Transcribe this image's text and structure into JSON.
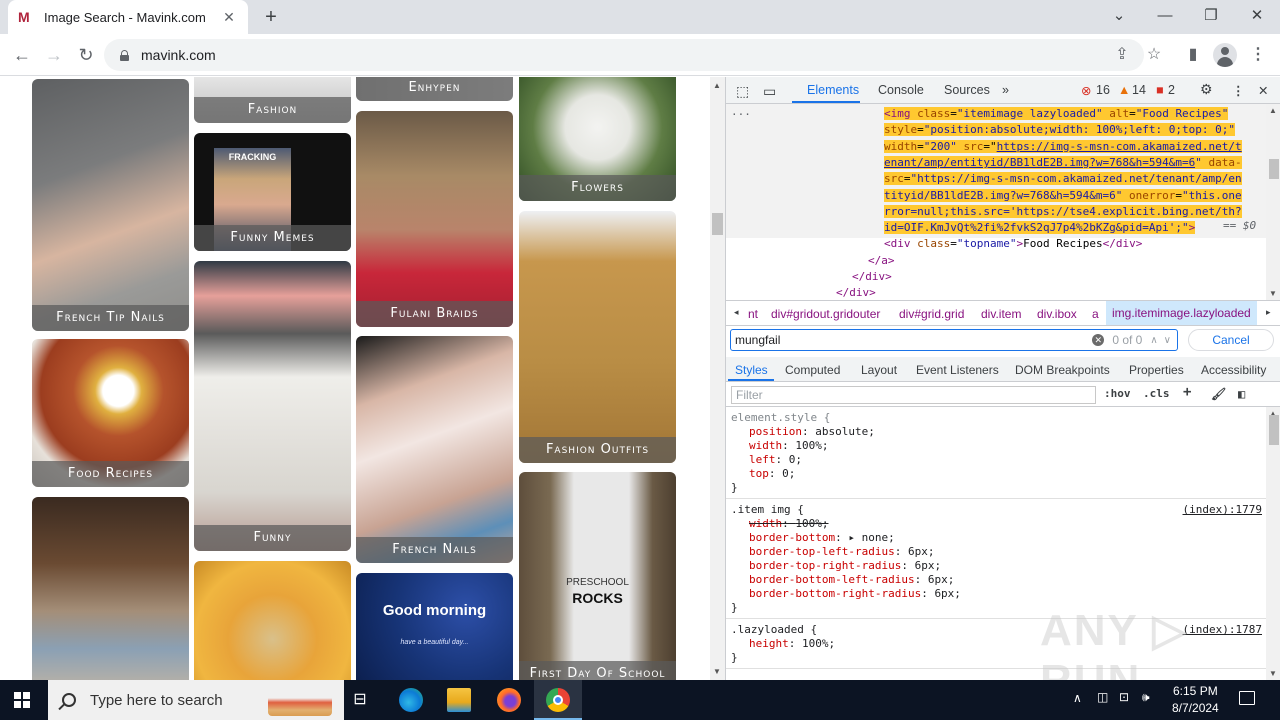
{
  "browser": {
    "tab_title": "Image Search - Mavink.com",
    "tab_favicon": "M",
    "url": "mavink.com",
    "window_controls": [
      "chevron-down-icon",
      "minimize-icon",
      "restore-icon",
      "close-icon"
    ],
    "toolbar_icons": [
      "share-icon",
      "bookmark-star-icon",
      "side-panel-icon",
      "profile-avatar-icon",
      "kebab-menu-icon"
    ]
  },
  "page": {
    "cards": [
      {
        "caption": "French Tip Nails",
        "color": "#8d8b88"
      },
      {
        "caption": "Food Recipes",
        "color": "#b5532c"
      },
      {
        "caption": "",
        "color": "#7d6a58"
      },
      {
        "caption": "Fashion",
        "color": "#c9c6c1"
      },
      {
        "caption": "Funny Memes",
        "color": "#111111"
      },
      {
        "caption": "Funny",
        "color": "#e6e3df"
      },
      {
        "caption": "",
        "color": "#e4a02c"
      },
      {
        "caption": "Enhypen",
        "color": "#b5b5b5"
      },
      {
        "caption": "Fulani Braids",
        "color": "#9a7a5d"
      },
      {
        "caption": "French Nails",
        "color": "#c6a89a"
      },
      {
        "caption": "",
        "color": "#1b3b8a"
      },
      {
        "caption": "Flowers",
        "color": "#5f7d45"
      },
      {
        "caption": "Fashion Outfits",
        "color": "#b98d45"
      },
      {
        "caption": "First Day Of School",
        "color": "#7a6a52"
      }
    ],
    "meme_text": "FRACKING",
    "good_morning_text": "Good morning",
    "good_morning_sub": "have a beautiful day...",
    "shirt_text": [
      "PRESCHOOL",
      "ROCKS"
    ]
  },
  "devtools": {
    "tabs": [
      "Elements",
      "Console",
      "Sources"
    ],
    "active_tab": "Elements",
    "more_tabs": "»",
    "errors": "16",
    "warnings": "14",
    "issues": "2",
    "dom_lines": [
      {
        "indent": 0,
        "parts": [
          [
            "tag",
            "<img "
          ],
          [
            "attr",
            "class"
          ],
          [
            "",
            "="
          ],
          [
            "val",
            "\"itemimage lazyloaded\""
          ],
          [
            "",
            " "
          ],
          [
            "attr",
            "alt"
          ],
          [
            "",
            "="
          ],
          [
            "val",
            "\"Food Recipes\""
          ]
        ]
      },
      {
        "indent": 0,
        "parts": [
          [
            "attr",
            "style"
          ],
          [
            "",
            "="
          ],
          [
            "val",
            "\"position:absolute;width: 100%;left: 0;top: 0;\""
          ]
        ]
      },
      {
        "indent": 0,
        "parts": [
          [
            "attr",
            "width"
          ],
          [
            "",
            "="
          ],
          [
            "val",
            "\"200\""
          ],
          [
            "",
            " "
          ],
          [
            "attr",
            "src"
          ],
          [
            "",
            "=\""
          ],
          [
            "link",
            "https://img-s-msn-com.akamaized.net/t"
          ]
        ]
      },
      {
        "indent": 0,
        "parts": [
          [
            "link",
            "enant/amp/entityid/BB1ldE2B.img?w=768&h=594&m=6"
          ],
          [
            "val",
            "\""
          ],
          [
            "",
            " "
          ],
          [
            "attr",
            "data-"
          ]
        ]
      },
      {
        "indent": 0,
        "parts": [
          [
            "attr",
            "src"
          ],
          [
            "",
            "="
          ],
          [
            "val",
            "\"https://img-s-msn-com.akamaized.net/tenant/amp/en"
          ]
        ]
      },
      {
        "indent": 0,
        "parts": [
          [
            "val",
            "tityid/BB1ldE2B.img?w=768&h=594&m=6\""
          ],
          [
            "",
            " "
          ],
          [
            "attr",
            "onerror"
          ],
          [
            "",
            "="
          ],
          [
            "val",
            "\"this.one"
          ]
        ]
      },
      {
        "indent": 0,
        "parts": [
          [
            "val",
            "rror=null;this.src='https://tse4.explicit.bing.net/th?"
          ]
        ]
      },
      {
        "indent": 0,
        "parts": [
          [
            "val",
            "id=OIF.KmJvQt%2fi%2fvkS2qJ7p4%2bKZg&pid=Api';\""
          ],
          [
            "tag",
            ">"
          ]
        ]
      },
      {
        "indent": 0,
        "parts": [
          [
            "tag",
            "<div "
          ],
          [
            "attr",
            "class"
          ],
          [
            "",
            "="
          ],
          [
            "val",
            "\"topname\""
          ],
          [
            "tag",
            ">"
          ],
          [
            "",
            "Food Recipes"
          ],
          [
            "tag",
            "</div>"
          ]
        ]
      },
      {
        "indent": 1,
        "parts": [
          [
            "tag",
            "</a>"
          ]
        ]
      },
      {
        "indent": 2,
        "parts": [
          [
            "tag",
            "</div>"
          ]
        ]
      },
      {
        "indent": 3,
        "parts": [
          [
            "tag",
            "</div>"
          ]
        ]
      }
    ],
    "selected_marker": "== $0",
    "ellipsis": "...",
    "breadcrumbs": [
      "nt",
      "div#gridout.gridouter",
      "div#grid.grid",
      "div.item",
      "div.ibox",
      "a",
      "img.itemimage.lazyloaded"
    ],
    "search": {
      "value": "mungfail",
      "count": "0 of 0",
      "cancel": "Cancel"
    },
    "subtabs": [
      "Styles",
      "Computed",
      "Layout",
      "Event Listeners",
      "DOM Breakpoints",
      "Properties",
      "Accessibility"
    ],
    "active_subtab": "Styles",
    "filter_placeholder": "Filter",
    "filter_tools": [
      ":hov",
      ".cls"
    ],
    "rules": [
      {
        "selector": "element.style {",
        "source": "",
        "props": [
          {
            "name": "position",
            "value": "absolute;",
            "struck": false
          },
          {
            "name": "width",
            "value": "100%;",
            "struck": false
          },
          {
            "name": "left",
            "value": "0;",
            "struck": false
          },
          {
            "name": "top",
            "value": "0;",
            "struck": false
          }
        ]
      },
      {
        "selector": ".item img {",
        "source": "(index):1779",
        "props": [
          {
            "name": "width",
            "value": "100%;",
            "struck": true
          },
          {
            "name": "border-bottom",
            "value": "▸ none;",
            "struck": false
          },
          {
            "name": "border-top-left-radius",
            "value": "6px;",
            "struck": false
          },
          {
            "name": "border-top-right-radius",
            "value": "6px;",
            "struck": false
          },
          {
            "name": "border-bottom-left-radius",
            "value": "6px;",
            "struck": false
          },
          {
            "name": "border-bottom-right-radius",
            "value": "6px;",
            "struck": false
          }
        ]
      },
      {
        "selector": ".lazyloaded {",
        "source": "(index):1787",
        "props": [
          {
            "name": "height",
            "value": "100%;",
            "struck": false
          }
        ]
      }
    ],
    "watermark": "ANY ▷ RUN"
  },
  "taskbar": {
    "search_placeholder": "Type here to search",
    "apps": [
      "task-view",
      "edge",
      "file-explorer",
      "firefox",
      "chrome"
    ],
    "time": "6:15 PM",
    "date": "8/7/2024"
  }
}
